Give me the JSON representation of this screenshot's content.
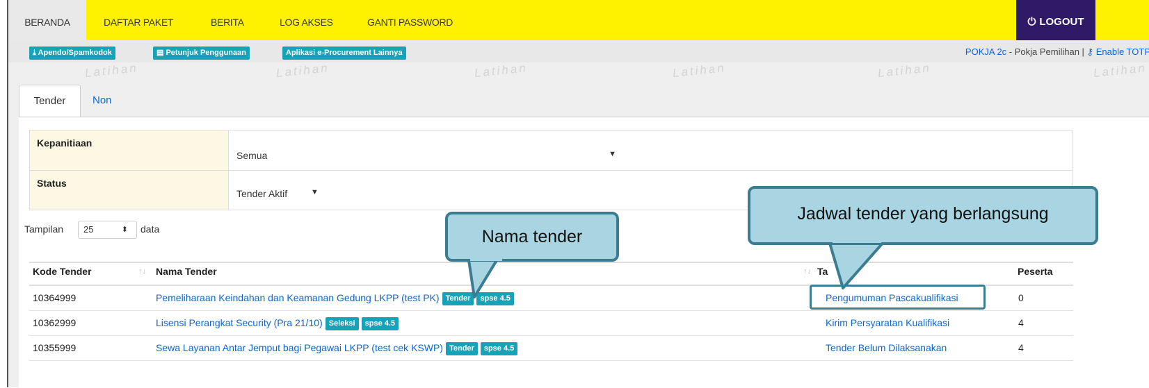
{
  "topnav": {
    "tabs": [
      "BERANDA",
      "DAFTAR PAKET",
      "BERITA",
      "LOG AKSES",
      "GANTI PASSWORD"
    ],
    "logout": "LOGOUT"
  },
  "subbar": {
    "buttons": [
      "Apendo/Spamkodok",
      "Petunjuk Penggunaan",
      "Aplikasi e-Procurement Lainnya"
    ],
    "user_name": "POKJA 2c",
    "user_role": " - Pokja Pemilihan | ",
    "enable_totp": "Enable TOTP"
  },
  "watermark": "Latihan",
  "tabs": [
    "Tender",
    "Non Tender"
  ],
  "filter": {
    "kepanitiaan_label": "Kepanitiaan",
    "kepanitiaan_value": "Semua",
    "status_label": "Status",
    "status_value": "Tender Aktif"
  },
  "tampilan": {
    "label": "Tampilan",
    "value": "25",
    "suffix": "data"
  },
  "table": {
    "headers": [
      "Kode Tender",
      "Nama Tender",
      "Ta",
      "Peserta"
    ],
    "rows": [
      {
        "kode": "10364999",
        "nama": "Pemeliharaan Keindahan dan Keamanan Gedung LKPP (test PK)",
        "badges": [
          "Tender",
          "spse 4.5"
        ],
        "tahap": "Pengumuman Pascakualifikasi",
        "peserta": "0"
      },
      {
        "kode": "10362999",
        "nama": "Lisensi Perangkat Security (Pra 21/10)",
        "badges": [
          "Seleksi",
          "spse 4.5"
        ],
        "tahap": "Kirim Persyaratan Kualifikasi",
        "peserta": "4"
      },
      {
        "kode": "10355999",
        "nama": "Sewa Layanan Antar Jemput bagi Pegawai LKPP (test cek KSWP)",
        "badges": [
          "Tender",
          "spse 4.5"
        ],
        "tahap": "Tender Belum Dilaksanakan",
        "peserta": "4"
      }
    ]
  },
  "callouts": {
    "nama_tender": "Nama tender",
    "jadwal": "Jadwal tender yang berlangsung"
  },
  "icons": {
    "logout": "power-icon",
    "download": "download-icon",
    "book": "book-icon",
    "key": "key-icon",
    "sort": "sort-icon",
    "caret": "caret-down-icon"
  },
  "colors": {
    "nav_yellow": "#fff200",
    "logout_bg": "#2e1a66",
    "badge": "#17a2b8",
    "link": "#0a66d6",
    "callout_fill": "#a9d4e2",
    "callout_border": "#3a7d91"
  }
}
